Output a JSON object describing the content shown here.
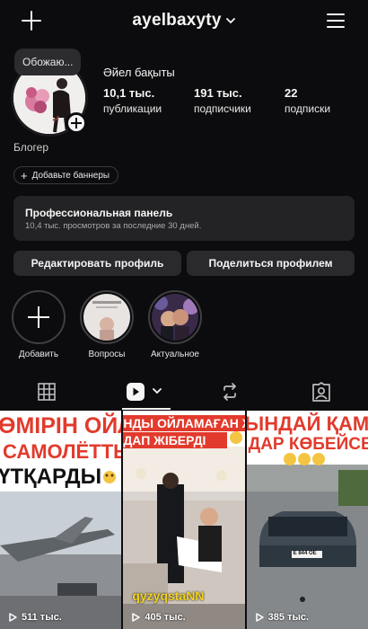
{
  "header": {
    "username": "ayelbaxyty"
  },
  "profile": {
    "note": "Обожаю...",
    "display_name": "Әйел бақыты",
    "stats": [
      {
        "value": "10,1 тыс.",
        "label": "публикации"
      },
      {
        "value": "191 тыс.",
        "label": "подписчики"
      },
      {
        "value": "22",
        "label": "подписки"
      }
    ],
    "category": "Блогер",
    "banner_button": "Добавьте баннеры"
  },
  "pro_panel": {
    "title": "Профессиональная панель",
    "subtitle": "10,4 тыс. просмотров за последние 30 дней."
  },
  "buttons": {
    "edit": "Редактировать профиль",
    "share": "Поделиться профилем"
  },
  "highlights": [
    {
      "label": "Добавить"
    },
    {
      "label": "Вопросы"
    },
    {
      "label": "Актуальное"
    }
  ],
  "tabs": [
    "grid-icon",
    "reels-icon",
    "reposts-icon",
    "tagged-icon"
  ],
  "posts": [
    {
      "line1": "ӨМІРІН ОЙЛА",
      "line2": "САМОЛЁТТЫ",
      "line3": "ҮТҚАРДЫ",
      "views": "511 тыс."
    },
    {
      "line1": "НДЫ ОЙЛАМАҒАН Ж",
      "line2": "ДАП ЖІБЕРДІ",
      "watermark": "qyzyqstaNN",
      "views": "405 тыс."
    },
    {
      "line1": "ЫНДАЙ ҚАМ",
      "line2": "ДАР КӨБЕЙСЕ",
      "plate": "Е 844 ОЕ",
      "views": "385 тыс."
    }
  ],
  "colors": {
    "background": "#0c0c0e",
    "panel": "#232325",
    "button": "#2a2a2c",
    "caption_red": "#e23a2c"
  }
}
